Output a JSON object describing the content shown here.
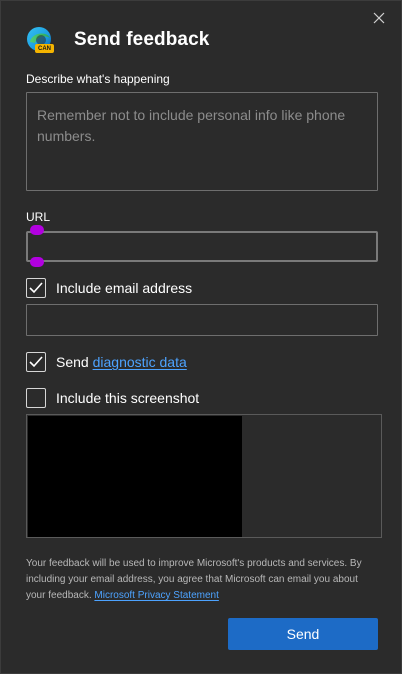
{
  "window": {
    "title": "Send feedback",
    "close_icon": "close-icon"
  },
  "logo": {
    "icon": "edge-canary-logo",
    "badge": "CAN"
  },
  "describe": {
    "label": "Describe what's happening",
    "placeholder": "Remember not to include personal info like phone numbers."
  },
  "url": {
    "label": "URL",
    "value": ""
  },
  "email": {
    "checkbox_label": "Include email address",
    "checked": true,
    "value": ""
  },
  "diagnostic": {
    "prefix": "Send",
    "link": "diagnostic data",
    "checked": true
  },
  "screenshot": {
    "label": "Include this screenshot",
    "checked": false
  },
  "disclaimer": {
    "text": "Your feedback will be used to improve Microsoft's products and services. By including your email address, you agree that Microsoft can email you about your feedback.",
    "link": "Microsoft Privacy Statement"
  },
  "actions": {
    "send_label": "Send"
  },
  "colors": {
    "accent": "#1d6bc6",
    "link": "#4da3ff",
    "background": "#2b2b2b",
    "handle": "#b200e0"
  }
}
